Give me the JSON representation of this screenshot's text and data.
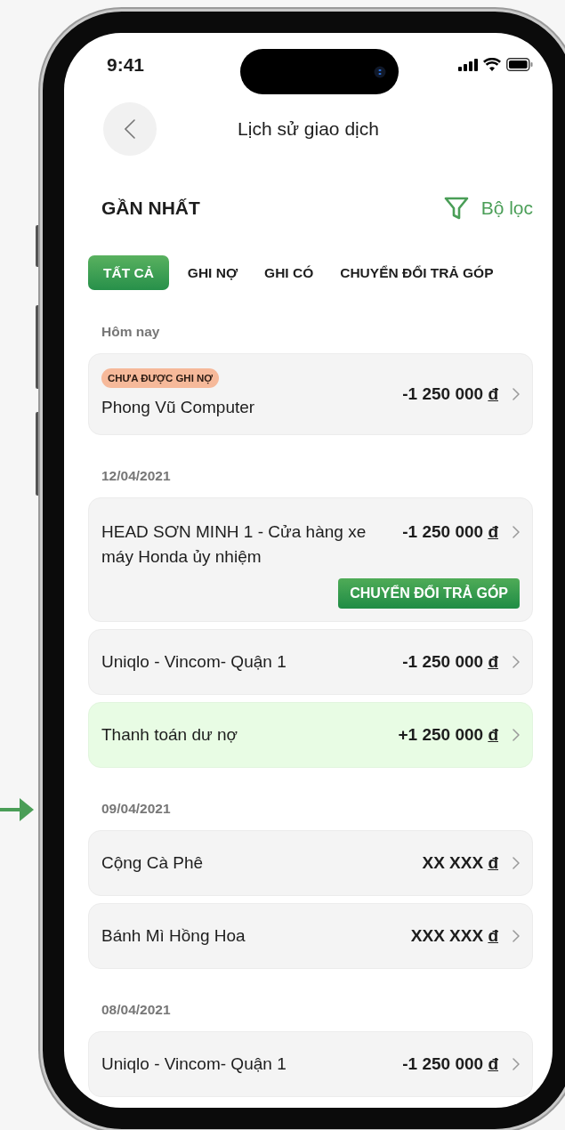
{
  "status_bar": {
    "time": "9:41"
  },
  "header": {
    "title": "Lịch sử giao dịch"
  },
  "section": {
    "title": "GẦN NHẤT",
    "filter_label": "Bộ lọc"
  },
  "tabs": [
    {
      "label": "TẤT CẢ",
      "selected": true
    },
    {
      "label": "GHI NỢ",
      "selected": false
    },
    {
      "label": "GHI CÓ",
      "selected": false
    },
    {
      "label": "CHUYỂN ĐỔI TRẢ GÓP",
      "selected": false
    }
  ],
  "groups": [
    {
      "date": "Hôm nay",
      "transactions": [
        {
          "kind": "debit",
          "badge": "CHƯA ĐƯỢC GHI NỢ",
          "name": "Phong Vũ Computer",
          "amount": "-1 250 000",
          "currency": "đ"
        }
      ]
    },
    {
      "date": "12/04/2021",
      "transactions": [
        {
          "kind": "debit",
          "name": "HEAD SƠN MINH 1 - Cửa hàng xe máy Honda ủy nhiệm",
          "amount": "-1 250 000",
          "currency": "đ",
          "action": "CHUYỂN ĐỔI TRẢ GÓP"
        },
        {
          "kind": "debit",
          "name": "Uniqlo - Vincom- Quận 1",
          "amount": "-1 250 000",
          "currency": "đ"
        },
        {
          "kind": "credit",
          "name": "Thanh toán dư nợ",
          "amount": "+1 250 000",
          "currency": "đ"
        }
      ]
    },
    {
      "date": "09/04/2021",
      "transactions": [
        {
          "kind": "debit",
          "name": "Cộng Cà Phê",
          "amount": "XX XXX",
          "currency": "đ"
        },
        {
          "kind": "debit",
          "name": "Bánh Mì Hồng Hoa",
          "amount": "XXX XXX",
          "currency": "đ"
        }
      ]
    },
    {
      "date": "08/04/2021",
      "transactions": [
        {
          "kind": "debit",
          "name": "Uniqlo - Vincom- Quận 1",
          "amount": "-1 250 000",
          "currency": "đ"
        }
      ]
    }
  ]
}
